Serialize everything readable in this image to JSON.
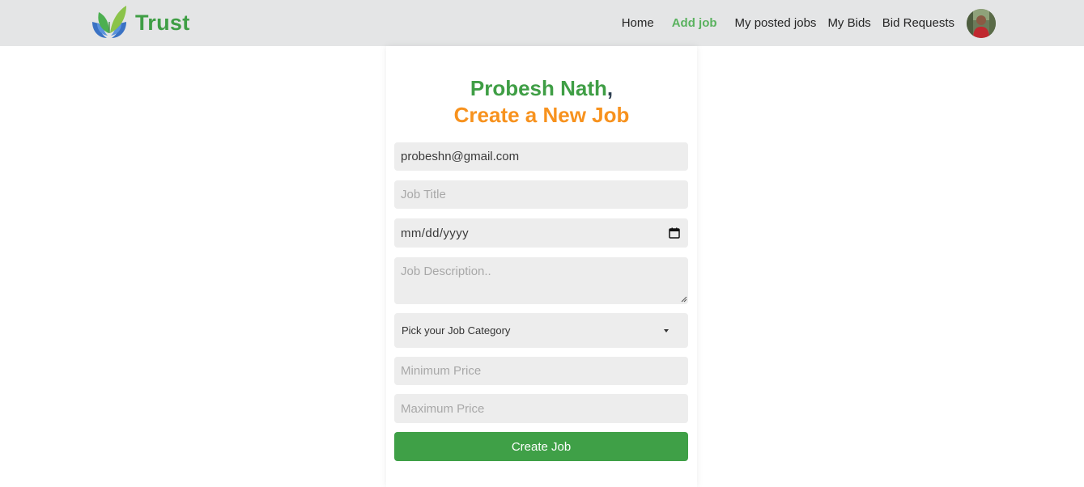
{
  "brand": {
    "name": "Trust"
  },
  "nav": {
    "home": "Home",
    "add_job": "Add job",
    "my_posted_jobs": "My posted jobs",
    "my_bids": "My Bids",
    "bid_requests": "Bid Requests"
  },
  "form": {
    "user_name": "Probesh Nath",
    "comma": ",",
    "subtitle": "Create a New Job",
    "email_value": "probeshn@gmail.com",
    "job_title_placeholder": "Job Title",
    "date_placeholder": "mm/dd/yyyy",
    "description_placeholder": "Job Description..",
    "category_selected": "Pick your Job Category",
    "min_price_placeholder": "Minimum Price",
    "max_price_placeholder": "Maximum Price",
    "submit_label": "Create Job"
  },
  "colors": {
    "brand_green": "#3f9e45",
    "active_nav": "#5ab25f",
    "heading_orange": "#f7921e",
    "button_green": "#3fa047",
    "navbar_bg": "#e4e5e6",
    "input_bg": "#ededed"
  },
  "icons": {
    "logo": "leaf-hands-logo-icon",
    "avatar": "user-avatar",
    "calendar": "calendar-icon",
    "select_caret": "caret-down-icon"
  }
}
